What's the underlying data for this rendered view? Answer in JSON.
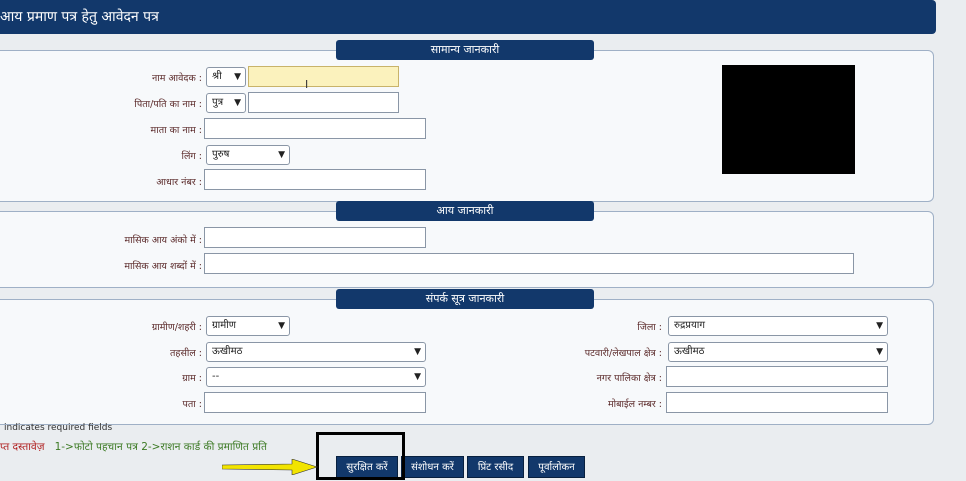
{
  "header": {
    "title": "आय प्रमाण पत्र हेतु आवेदन पत्र"
  },
  "sections": {
    "general": "सामान्य जानकारी",
    "income": "आय जानकारी",
    "contact": "संपर्क सूत्र जानकारी"
  },
  "general": {
    "applicant_label": "नाम आवेदक :",
    "applicant_prefix": "श्री",
    "applicant_value": "",
    "father_label": "पिता/पति का नाम :",
    "father_prefix": "पुत्र",
    "father_value": "",
    "mother_label": "माता का नाम :",
    "mother_value": "",
    "gender_label": "लिंग :",
    "gender_value": "पुरुष",
    "aadhaar_label": "आधार नंबर :",
    "aadhaar_value": ""
  },
  "income": {
    "monthly_digits_label": "मासिक आय अंको में :",
    "monthly_digits_value": "",
    "monthly_words_label": "मासिक आय शब्दों में :",
    "monthly_words_value": ""
  },
  "contact": {
    "area_label": "ग्रामीण/शहरी :",
    "area_value": "ग्रामीण",
    "tehsil_label": "तहसील :",
    "tehsil_value": "ऊखीमठ",
    "village_label": "ग्राम :",
    "village_value": "--",
    "address_label": "पता :",
    "address_value": "",
    "district_label": "जिला :",
    "district_value": "रुद्रप्रयाग",
    "patwari_label": "पटवारी/लेखपाल क्षेत्र :",
    "patwari_value": "ऊखीमठ",
    "nagar_label": "नगर पालिका क्षेत्र :",
    "nagar_value": "",
    "mobile_label": "मोबाईल नम्बर :",
    "mobile_value": ""
  },
  "required_note": "indicates required fields",
  "documents": {
    "prefix": "प्त दस्तावेज़",
    "text": "1->फोटो पहचान पत्र 2->राशन कार्ड की प्रमाणित प्रति"
  },
  "buttons": {
    "save": "सुरक्षित करें",
    "edit": "संशोधन करें",
    "print": "प्रिंट रसीद",
    "preview": "पूर्वालोकन"
  },
  "colors": {
    "header": "#12386b",
    "highlight": "#f2e400"
  }
}
